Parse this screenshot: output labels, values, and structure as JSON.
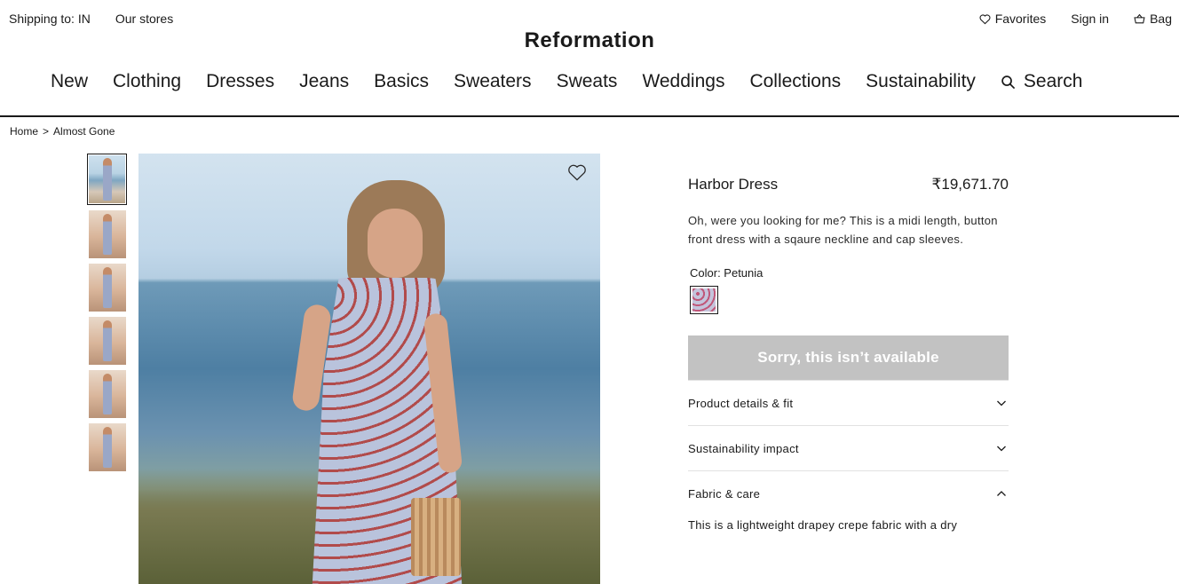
{
  "utility": {
    "shipping": "Shipping to: IN",
    "stores": "Our stores",
    "favorites": "Favorites",
    "sign_in": "Sign in",
    "bag": "Bag"
  },
  "brand": {
    "logo": "Reformation"
  },
  "nav": {
    "items": [
      "New",
      "Clothing",
      "Dresses",
      "Jeans",
      "Basics",
      "Sweaters",
      "Sweats",
      "Weddings",
      "Collections",
      "Sustainability"
    ],
    "search": "Search"
  },
  "breadcrumb": {
    "home": "Home",
    "sep": ">",
    "current": "Almost Gone"
  },
  "product": {
    "name": "Harbor Dress",
    "price": "₹19,671.70",
    "description": "Oh, were you looking for me? This is a midi length, button front dress with a sqaure neckline and cap sleeves.",
    "color_label": "Color: Petunia",
    "cta": "Sorry, this isn’t available",
    "accordions": [
      {
        "label": "Product details & fit",
        "expanded": false
      },
      {
        "label": "Sustainability impact",
        "expanded": false
      },
      {
        "label": "Fabric & care",
        "expanded": true
      }
    ],
    "fabric_text": "This is a lightweight drapey crepe fabric with a dry"
  },
  "icons": {
    "favorites": "heart-outline-icon",
    "bag": "basket-icon",
    "search": "magnifier-icon",
    "wishlist": "heart-outline-icon",
    "collapse": "chevron-down-icon",
    "expand": "chevron-up-icon"
  },
  "colors": {
    "text": "#1a1a1a",
    "cta_disabled": "#c2c2c2",
    "divider": "#e2e2e2"
  },
  "thumbnails_count": 6
}
